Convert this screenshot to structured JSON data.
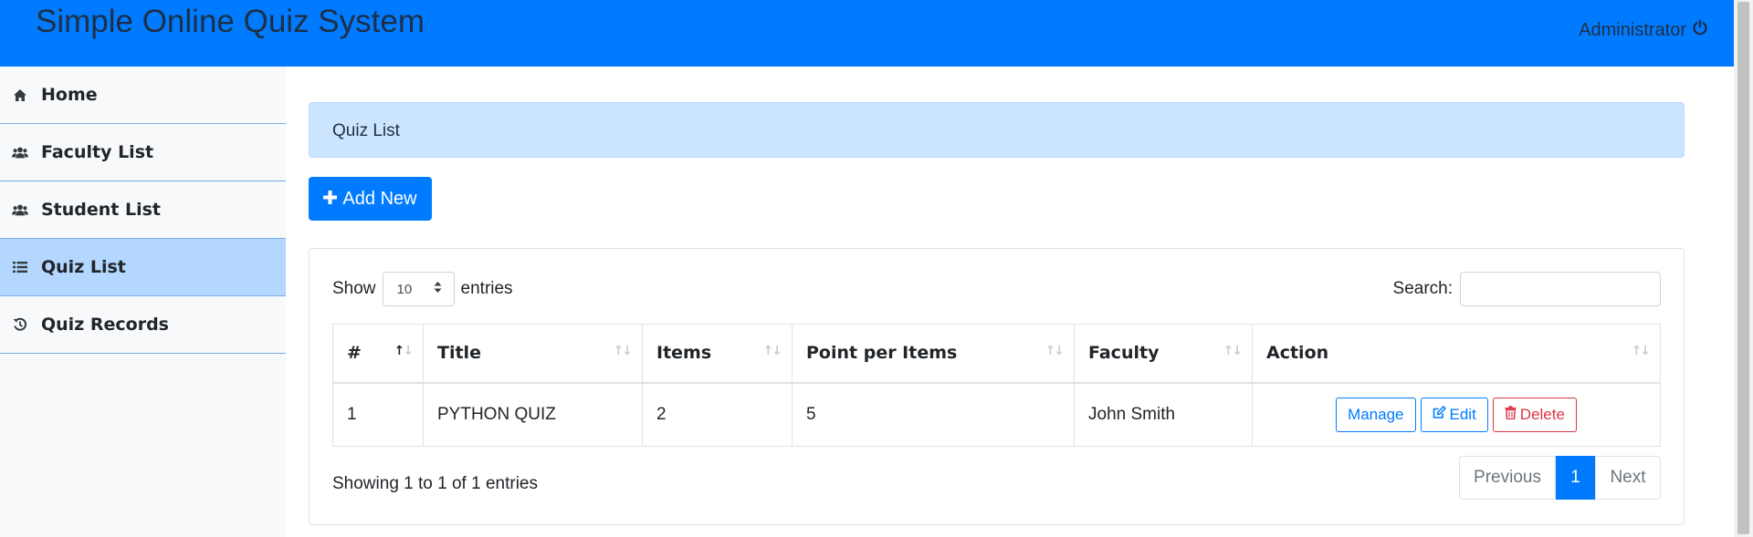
{
  "header": {
    "title": "Simple Online Quiz System",
    "user": "Administrator",
    "power_icon": "power-icon"
  },
  "sidebar": {
    "items": [
      {
        "label": "Home",
        "icon": "home-icon",
        "active": false
      },
      {
        "label": "Faculty List",
        "icon": "users-icon",
        "active": false
      },
      {
        "label": "Student List",
        "icon": "users-icon",
        "active": false
      },
      {
        "label": "Quiz List",
        "icon": "list-icon",
        "active": true
      },
      {
        "label": "Quiz Records",
        "icon": "history-icon",
        "active": false
      }
    ]
  },
  "main": {
    "alert_title": "Quiz List",
    "add_button": "Add New",
    "show_label": "Show",
    "entries_label": "entries",
    "page_size": "10",
    "search_label": "Search:",
    "search_value": "",
    "table": {
      "headers": [
        "#",
        "Title",
        "Items",
        "Point per Items",
        "Faculty",
        "Action"
      ],
      "rows": [
        {
          "num": "1",
          "title": "PYTHON QUIZ",
          "items": "2",
          "points": "5",
          "faculty": "John Smith"
        }
      ],
      "actions": {
        "manage": "Manage",
        "edit": "Edit",
        "delete": "Delete"
      }
    },
    "info": "Showing 1 to 1 of 1 entries",
    "pagination": {
      "previous": "Previous",
      "current": "1",
      "next": "Next"
    }
  },
  "colors": {
    "primary": "#007bff",
    "danger": "#dc3545",
    "alert_bg": "#cce5ff",
    "sidebar_active": "#b3d7ff"
  }
}
